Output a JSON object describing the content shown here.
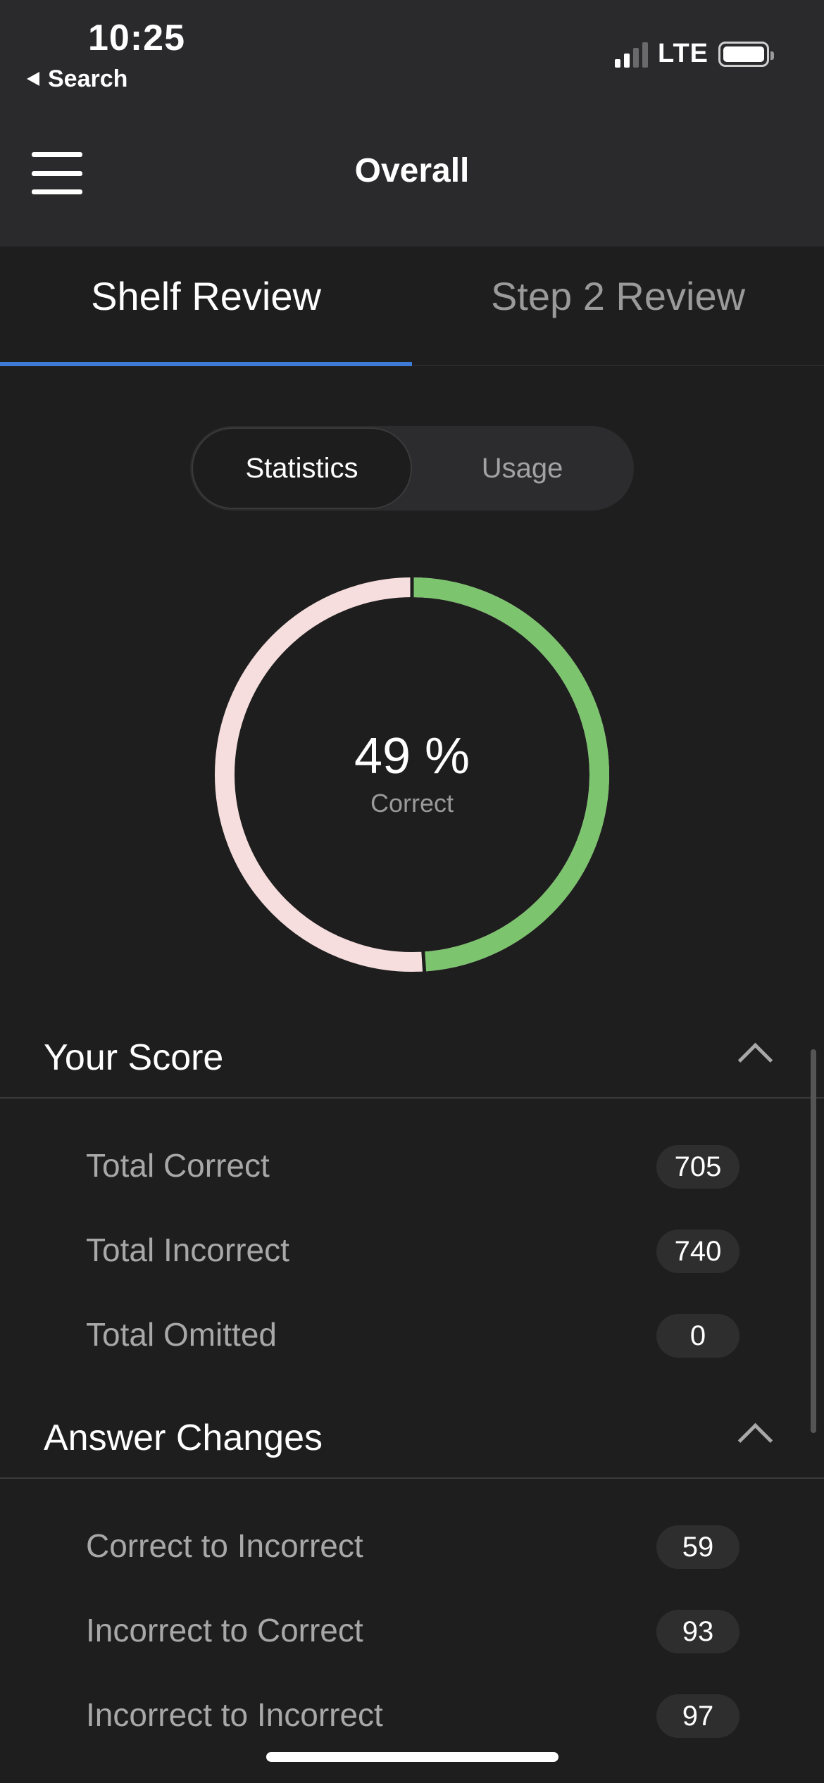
{
  "status_bar": {
    "time": "10:25",
    "back_label": "Search",
    "network": "LTE",
    "signal_bars": 2
  },
  "nav": {
    "title": "Overall",
    "menu_icon": "hamburger-icon"
  },
  "tabs": [
    {
      "label": "Shelf Review",
      "active": true
    },
    {
      "label": "Step 2 Review",
      "active": false
    }
  ],
  "segmented": [
    {
      "label": "Statistics",
      "active": true
    },
    {
      "label": "Usage",
      "active": false
    }
  ],
  "score_chart": {
    "value_text": "49 %",
    "label": "Correct",
    "correct_fraction": 0.49,
    "colors": {
      "correct": "#7cc46e",
      "remaining": "#f7dede"
    }
  },
  "sections": {
    "your_score": {
      "title": "Your Score",
      "rows": [
        {
          "label": "Total Correct",
          "value": "705"
        },
        {
          "label": "Total Incorrect",
          "value": "740"
        },
        {
          "label": "Total Omitted",
          "value": "0"
        }
      ]
    },
    "answer_changes": {
      "title": "Answer Changes",
      "rows": [
        {
          "label": "Correct to Incorrect",
          "value": "59"
        },
        {
          "label": "Incorrect to Correct",
          "value": "93"
        },
        {
          "label": "Incorrect to Incorrect",
          "value": "97"
        }
      ]
    }
  },
  "colors": {
    "background": "#1e1e1e",
    "header": "#2a2a2c",
    "tab_accent": "#3d7bd6"
  }
}
